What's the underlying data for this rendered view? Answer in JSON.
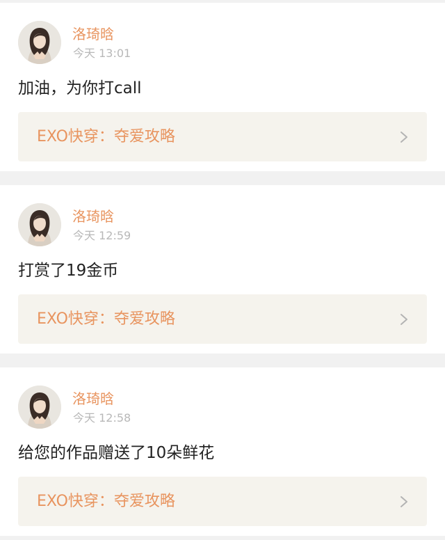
{
  "colors": {
    "accent": "#e8945f",
    "timestamp": "#b8b8b8",
    "message_text": "#222222",
    "link_bg": "#f5f3ed",
    "separator": "#f1f1f1"
  },
  "feed": {
    "items": [
      {
        "user_name": "洛琦晗",
        "timestamp": "今天 13:01",
        "message": "加油，为你打call",
        "book_title": "EXO快穿：夺爱攻略",
        "link_icon": "chevron-right-icon"
      },
      {
        "user_name": "洛琦晗",
        "timestamp": "今天 12:59",
        "message": "打赏了19金币",
        "book_title": "EXO快穿：夺爱攻略",
        "link_icon": "chevron-right-icon"
      },
      {
        "user_name": "洛琦晗",
        "timestamp": "今天 12:58",
        "message": "给您的作品赠送了10朵鲜花",
        "book_title": "EXO快穿：夺爱攻略",
        "link_icon": "chevron-right-icon"
      }
    ]
  }
}
